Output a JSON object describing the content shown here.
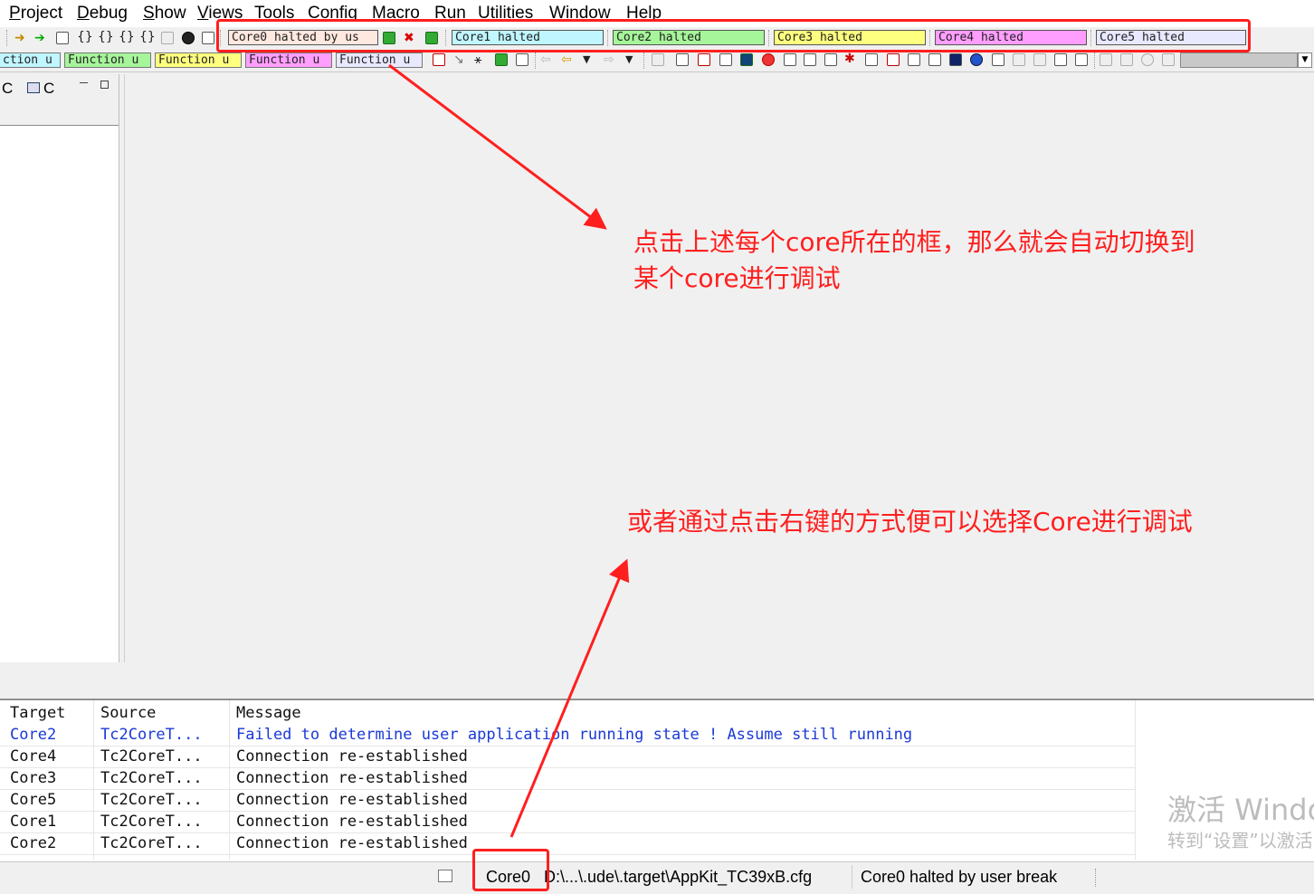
{
  "menu": [
    "Project",
    "Debug",
    "Show",
    "Views",
    "Tools",
    "Config",
    "Macro",
    "Run",
    "Utilities",
    "Window",
    "Help"
  ],
  "cores": [
    {
      "label": "Core0 halted by us",
      "color": "#ffe8e0"
    },
    {
      "label": "Core1 halted",
      "color": "#bff6ff"
    },
    {
      "label": "Core2 halted",
      "color": "#a6f59a"
    },
    {
      "label": "Core3 halted",
      "color": "#ffff7f"
    },
    {
      "label": "Core4 halted",
      "color": "#ff9eff"
    },
    {
      "label": "Core5 halted",
      "color": "#e8e8ff"
    }
  ],
  "function_tabs": [
    {
      "label": "ction u",
      "color": "#bff6ff"
    },
    {
      "label": "Function u",
      "color": "#a6f59a"
    },
    {
      "label": "Function u",
      "color": "#ffff7f"
    },
    {
      "label": "Function u",
      "color": "#ff9eff"
    },
    {
      "label": "Function u",
      "color": "#e8e8ff"
    }
  ],
  "left_panel": {
    "tab1": "C",
    "tab2": "C"
  },
  "messages": {
    "headers": [
      "Target",
      "Source",
      "Message"
    ],
    "rows": [
      {
        "target": "Core2",
        "source": "Tc2CoreT...",
        "message": "Failed to determine user application running state ! Assume still running",
        "highlight": true
      },
      {
        "target": "Core4",
        "source": "Tc2CoreT...",
        "message": "Connection re-established",
        "highlight": false
      },
      {
        "target": "Core3",
        "source": "Tc2CoreT...",
        "message": "Connection re-established",
        "highlight": false
      },
      {
        "target": "Core5",
        "source": "Tc2CoreT...",
        "message": "Connection re-established",
        "highlight": false
      },
      {
        "target": "Core1",
        "source": "Tc2CoreT...",
        "message": "Connection re-established",
        "highlight": false
      },
      {
        "target": "Core2",
        "source": "Tc2CoreT...",
        "message": "Connection re-established",
        "highlight": false
      }
    ]
  },
  "status": {
    "core": "Core0",
    "path": "D:\\...\\.ude\\.target\\AppKit_TC39xB.cfg",
    "state": "Core0 halted by user break"
  },
  "annotations": {
    "top_line1": "点击上述每个core所在的框，那么就会自动切换到",
    "top_line2": "某个core进行调试",
    "bottom": "或者通过点击右键的方式便可以选择Core进行调试",
    "color": "#ff1f1f"
  },
  "watermark": {
    "line1": "激活 Windo",
    "line2": "转到“设置”以激活"
  }
}
